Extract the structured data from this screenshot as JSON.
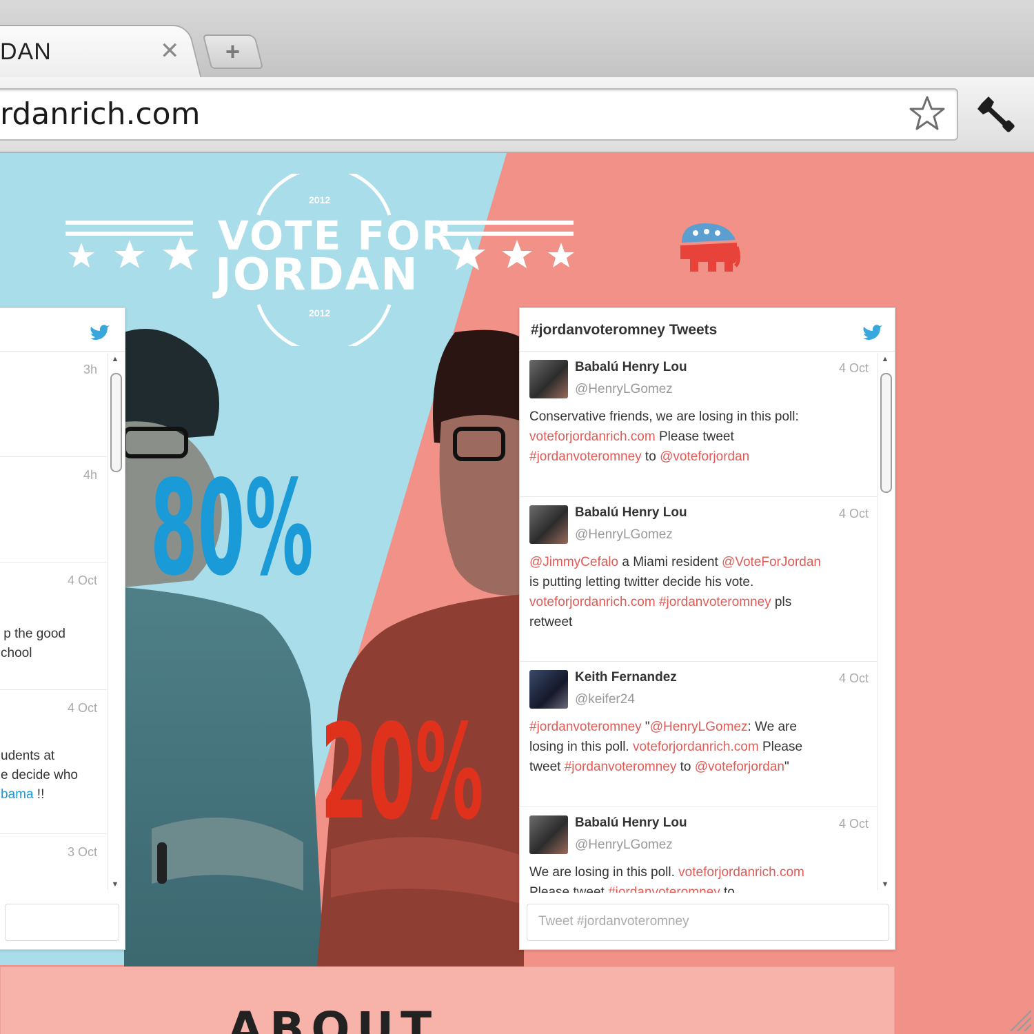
{
  "browser": {
    "tab_title": "DAN",
    "tab_close": "✕",
    "new_tab": "+",
    "url": "rdanrich.com"
  },
  "logo": {
    "line1": "VOTE FOR",
    "line2": "JORDAN",
    "year_top": "2012",
    "year_bottom": "2012"
  },
  "poll": {
    "blue_percent": "80%",
    "red_percent": "20%",
    "blue_value": 80,
    "red_value": 20
  },
  "left_widget": {
    "tweets": [
      {
        "time": "3h"
      },
      {
        "time": "4h"
      },
      {
        "time": "4 Oct",
        "line1": "p the good",
        "line2": "chool"
      },
      {
        "time": "4 Oct",
        "line1": "udents at",
        "line2": "e decide who",
        "line3_link": "bama",
        "line3_rest": " !!"
      },
      {
        "time": "3 Oct"
      }
    ]
  },
  "right_widget": {
    "title": "#jordanvoteromney Tweets",
    "input_placeholder": "Tweet #jordanvoteromney",
    "tweets": [
      {
        "name": "Babalú Henry Lou",
        "handle": "@HenryLGomez",
        "time": "4 Oct",
        "t1": "Conservative friends, we are losing in this poll:",
        "t2_link": "voteforjordanrich.com",
        "t2_rest": " Please tweet",
        "t3_link": "#jordanvoteromney",
        "t3_mid": " to ",
        "t3_link2": "@voteforjordan"
      },
      {
        "name": "Babalú Henry Lou",
        "handle": "@HenryLGomez",
        "time": "4 Oct",
        "t1_link": "@JimmyCefalo",
        "t1_mid": " a Miami resident ",
        "t1_link2": "@VoteForJordan",
        "t2": "is putting letting twitter decide his vote.",
        "t3_link": "voteforjordanrich.com",
        "t3_sp": " ",
        "t3_link2": "#jordanvoteromney",
        "t3_rest": " pls",
        "t4": "retweet"
      },
      {
        "name": "Keith Fernandez",
        "handle": "@keifer24",
        "time": "4 Oct",
        "t1_link": "#jordanvoteromney",
        "t1_mid": " \"",
        "t1_link2": "@HenryLGomez",
        "t1_rest": ": We are",
        "t2_a": "losing in this poll. ",
        "t2_link": "voteforjordanrich.com",
        "t2_rest": " Please",
        "t3_a": "tweet ",
        "t3_link": "#jordanvoteromney",
        "t3_mid": " to ",
        "t3_link2": "@voteforjordan",
        "t3_rest": "\""
      },
      {
        "name": "Babalú Henry Lou",
        "handle": "@HenryLGomez",
        "time": "4 Oct",
        "t1_a": "We are losing in this poll. ",
        "t1_link": "voteforjordanrich.com",
        "t2_a": "Please tweet ",
        "t2_link": "#jordanvoteromney",
        "t2_rest": " to"
      }
    ]
  },
  "about": {
    "heading": "ABOUT"
  },
  "colors": {
    "blue_bg": "#a8dde9",
    "red_bg": "#f19187",
    "blue_accent": "#1a9ad6",
    "red_accent": "#e0311d",
    "link_red": "#e05b55"
  },
  "icons": [
    "star-icon",
    "wrench-icon",
    "elephant-icon",
    "bird-icon",
    "close-icon",
    "plus-icon",
    "resize-icon"
  ]
}
